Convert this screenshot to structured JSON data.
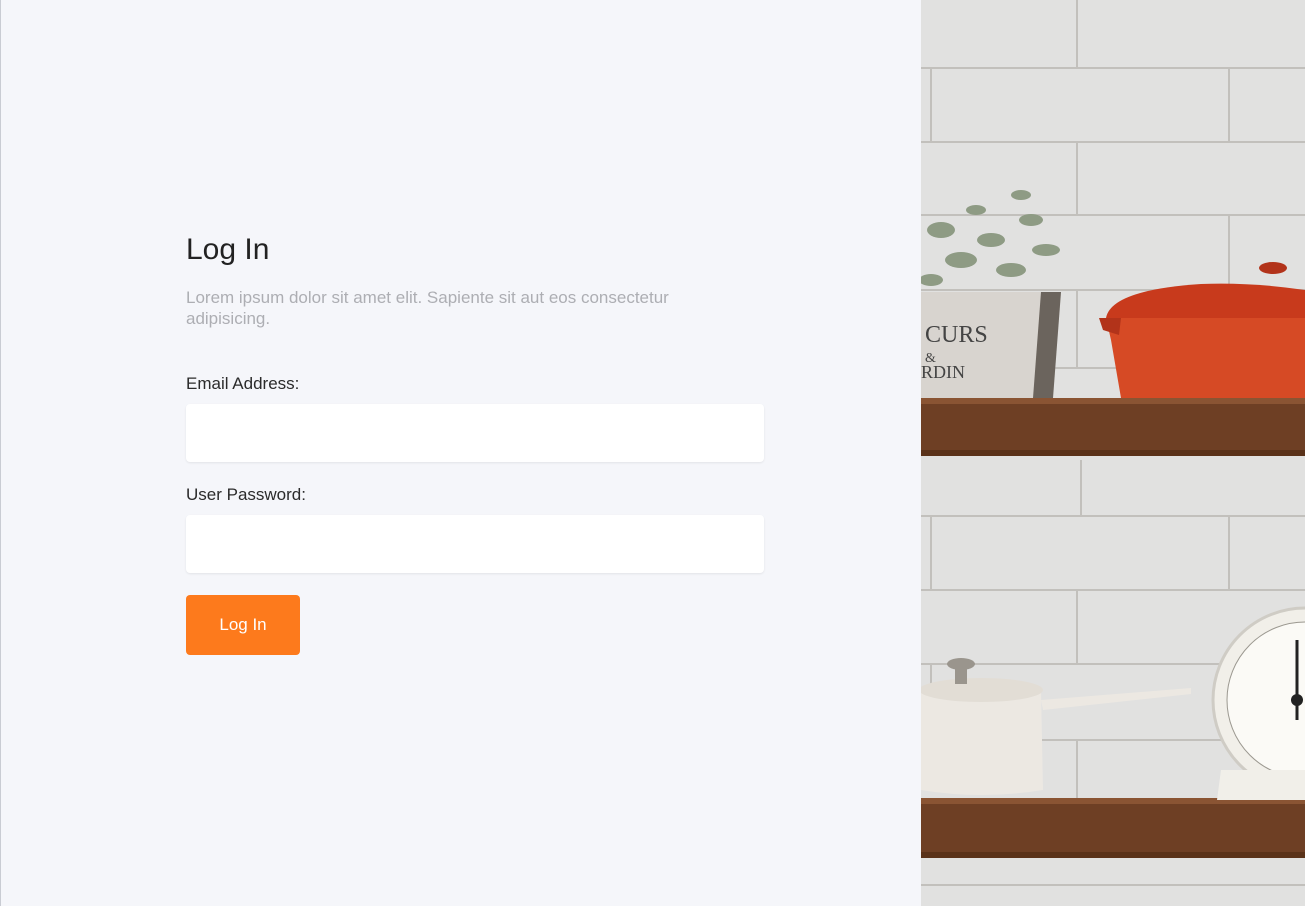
{
  "login": {
    "title": "Log In",
    "subtitle": "Lorem ipsum dolor sit amet elit. Sapiente sit aut eos consectetur adipisicing.",
    "email_label": "Email Address:",
    "email_value": "",
    "password_label": "User Password:",
    "password_value": "",
    "submit_label": "Log In"
  },
  "hero_image": {
    "description_icon": "kitchen-shelves-image",
    "pot_text": "CURS & RDIN"
  },
  "colors": {
    "background": "#f5f6fa",
    "accent": "#fd7a1c",
    "title": "#222222",
    "subtitle": "#adaeb3"
  }
}
